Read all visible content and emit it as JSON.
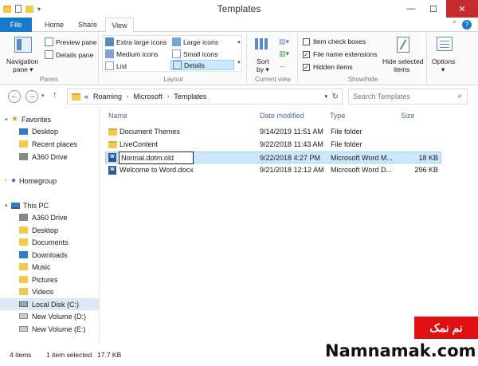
{
  "window": {
    "title": "Templates",
    "minimize": "—",
    "maximize": "☐",
    "close": "✕"
  },
  "tabs": {
    "file": "File",
    "home": "Home",
    "share": "Share",
    "view": "View"
  },
  "ribbon": {
    "panes": {
      "label": "Panes",
      "navigation_pane": "Navigation",
      "navigation_pane_2": "pane ▾",
      "preview_pane": "Preview pane",
      "details_pane": "Details pane"
    },
    "layout": {
      "label": "Layout",
      "extra_large": "Extra large icons",
      "large": "Large icons",
      "medium": "Medium icons",
      "small": "Small icons",
      "list": "List",
      "details": "Details"
    },
    "current_view": {
      "label": "Current view",
      "sort_by": "Sort",
      "sort_by_2": "by ▾"
    },
    "show_hide": {
      "label": "Show/hide",
      "item_check_boxes": "Item check boxes",
      "file_name_extensions": "File name extensions",
      "hidden_items": "Hidden items",
      "hide_selected_1": "Hide selected",
      "hide_selected_2": "items"
    },
    "options": {
      "label": "Options",
      "arrow": "▾"
    }
  },
  "address": {
    "chevrons": "«",
    "crumbs": [
      "Roaming",
      "Microsoft",
      "Templates"
    ],
    "search_placeholder": "Search Templates"
  },
  "nav": {
    "favorites": "Favorites",
    "desktop": "Desktop",
    "recent_places": "Recent places",
    "a360_drive": "A360 Drive",
    "homegroup": "Homegroup",
    "this_pc": "This PC",
    "pc_a360": "A360 Drive",
    "pc_desktop": "Desktop",
    "documents": "Documents",
    "downloads": "Downloads",
    "music": "Music",
    "pictures": "Pictures",
    "videos": "Videos",
    "local_disk": "Local Disk (C:)",
    "vol_d": "New Volume (D:)",
    "vol_e": "New Volume (E:)"
  },
  "columns": {
    "name": "Name",
    "date_modified": "Date modified",
    "type": "Type",
    "size": "Size"
  },
  "files": [
    {
      "name": "Document Themes",
      "date": "9/14/2019 11:51 AM",
      "type": "File folder",
      "size": ""
    },
    {
      "name": "LiveContent",
      "date": "9/22/2018 11:43 AM",
      "type": "File folder",
      "size": ""
    },
    {
      "name": "Normal.dotm.old",
      "date": "9/22/2018 4:27 PM",
      "type": "Microsoft Word M...",
      "size": "18 KB"
    },
    {
      "name": "Welcome to Word.docx",
      "date": "9/21/2018 12:12 AM",
      "type": "Microsoft Word D...",
      "size": "296 KB"
    }
  ],
  "status": {
    "count": "4 items",
    "selected": "1 item selected",
    "size": "17.7 KB"
  },
  "watermark": {
    "logo": "نم نمک",
    "site": "Namnamak.com"
  }
}
